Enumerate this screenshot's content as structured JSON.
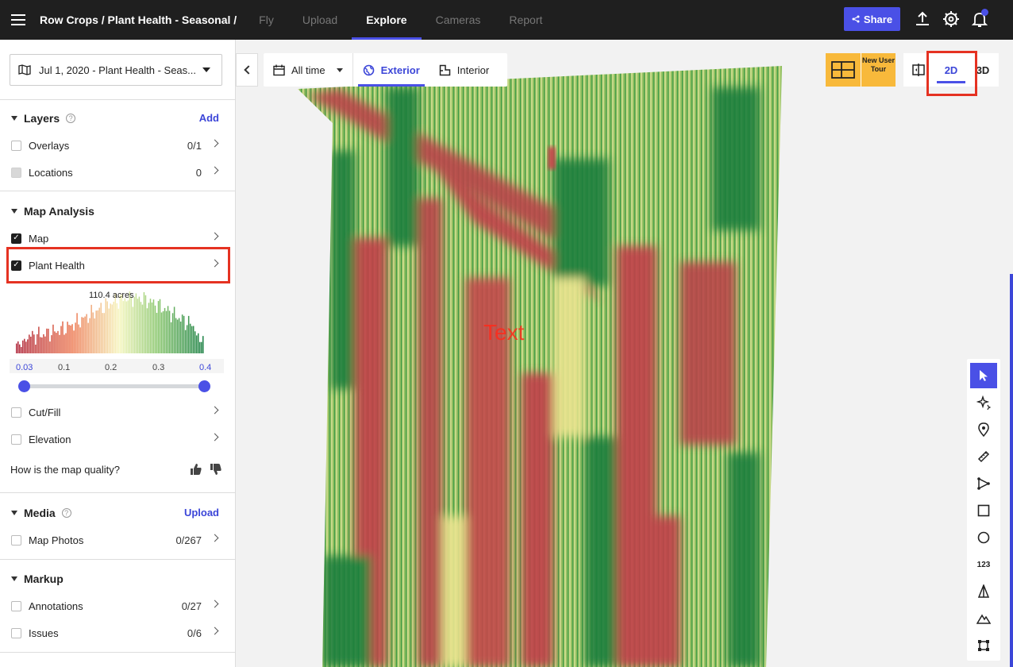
{
  "header": {
    "breadcrumb": "Row Crops / Plant Health - Seasonal /",
    "tabs": [
      {
        "label": "Fly"
      },
      {
        "label": "Upload"
      },
      {
        "label": "Explore"
      },
      {
        "label": "Cameras"
      },
      {
        "label": "Report"
      }
    ],
    "active_tab": "Explore",
    "share_label": "Share",
    "icons": [
      "upload-icon",
      "gear-icon",
      "bell-icon"
    ]
  },
  "sidebar": {
    "date_select": "Jul 1, 2020 - Plant Health - Seas...",
    "layers": {
      "title": "Layers",
      "action": "Add",
      "items": [
        {
          "label": "Overlays",
          "count": "0/1"
        },
        {
          "label": "Locations",
          "count": "0"
        }
      ]
    },
    "map_analysis": {
      "title": "Map Analysis",
      "items": [
        {
          "label": "Map",
          "checked": true
        },
        {
          "label": "Plant Health",
          "checked": true
        }
      ],
      "histogram": {
        "acres_label": "110.4 acres",
        "ticks": [
          "0.03",
          "0.1",
          "0.2",
          "0.3",
          "0.4"
        ],
        "range_min": 0.03,
        "range_max": 0.4
      },
      "extra_items": [
        {
          "label": "Cut/Fill"
        },
        {
          "label": "Elevation"
        }
      ],
      "quality_prompt": "How is the map quality?"
    },
    "media": {
      "title": "Media",
      "action": "Upload",
      "items": [
        {
          "label": "Map Photos",
          "count": "0/267"
        }
      ]
    },
    "markup": {
      "title": "Markup",
      "items": [
        {
          "label": "Annotations",
          "count": "0/27"
        },
        {
          "label": "Issues",
          "count": "0/6"
        }
      ]
    }
  },
  "map": {
    "time_filter": "All time",
    "view_tabs": [
      {
        "label": "Exterior"
      },
      {
        "label": "Interior"
      }
    ],
    "active_view": "Exterior",
    "tour_label": "New User Tour",
    "dim_buttons": [
      "2D",
      "3D"
    ],
    "active_dim": "2D",
    "overlay_text": "Text",
    "tools": [
      "pointer-icon",
      "magic-icon",
      "location-pin-icon",
      "ruler-icon",
      "polyline-icon",
      "square-icon",
      "circle-icon",
      "count-tool",
      "volume-icon",
      "terrain-icon",
      "crop-icon"
    ],
    "count_tool_label": "123"
  },
  "colors": {
    "accent": "#4a50e6",
    "highlight": "#e53222",
    "tour": "#f8b93b",
    "health_low": "#c0404a",
    "health_mid": "#e9e48f",
    "health_high": "#1e7f3e"
  }
}
